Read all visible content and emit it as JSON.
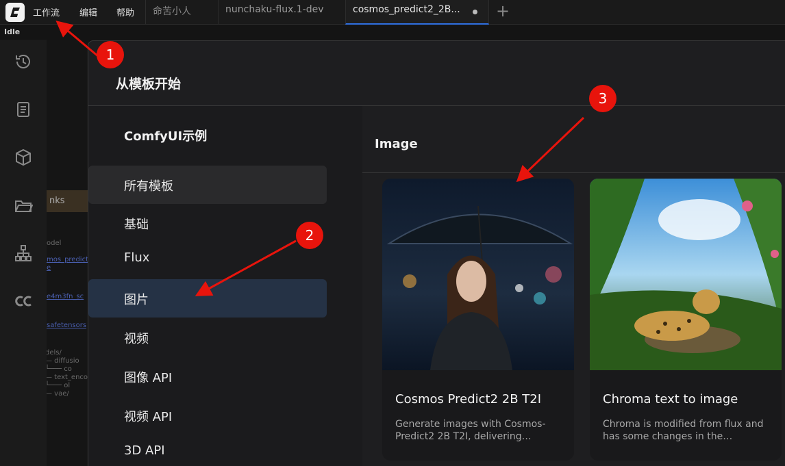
{
  "topbar": {
    "menu": [
      "工作流",
      "编辑",
      "帮助"
    ],
    "user_tab": "命苦小人",
    "tabs": [
      {
        "label": "nunchaku-flux.1-dev"
      },
      {
        "label": "cosmos_predict2_2B...",
        "active": true
      }
    ],
    "add_tab_icon": "plus-icon"
  },
  "status": {
    "text": "Idle"
  },
  "sidebar": {
    "icons": [
      "history-icon",
      "book-icon",
      "cube-icon",
      "folder-icon",
      "nodes-tree-icon",
      "cc-icon"
    ]
  },
  "canvas_bg": {
    "texts": [
      "nks",
      "odel",
      "mos_predict2",
      "e",
      "e4m3fn_sc",
      "safetensors",
      "dels/",
      "— diffusio",
      "└─── co",
      "— text_enco",
      "└─── ol",
      "— vae/"
    ]
  },
  "dialog": {
    "title": "从模板开始",
    "nav": {
      "title": "ComfyUI示例",
      "items": [
        "所有模板",
        "基础",
        "Flux",
        "图片",
        "视频",
        "图像 API",
        "视频 API",
        "3D API"
      ],
      "selected_index": 3
    },
    "section_title": "Image",
    "cards": [
      {
        "title": "Cosmos Predict2 2B T2I",
        "description": "Generate images with Cosmos-Predict2 2B T2I, delivering…"
      },
      {
        "title": "Chroma text to image",
        "description": "Chroma is modified from flux and has some changes in the…"
      }
    ]
  },
  "annotations": {
    "badges": [
      "1",
      "2",
      "3"
    ],
    "color": "#e8140c"
  }
}
